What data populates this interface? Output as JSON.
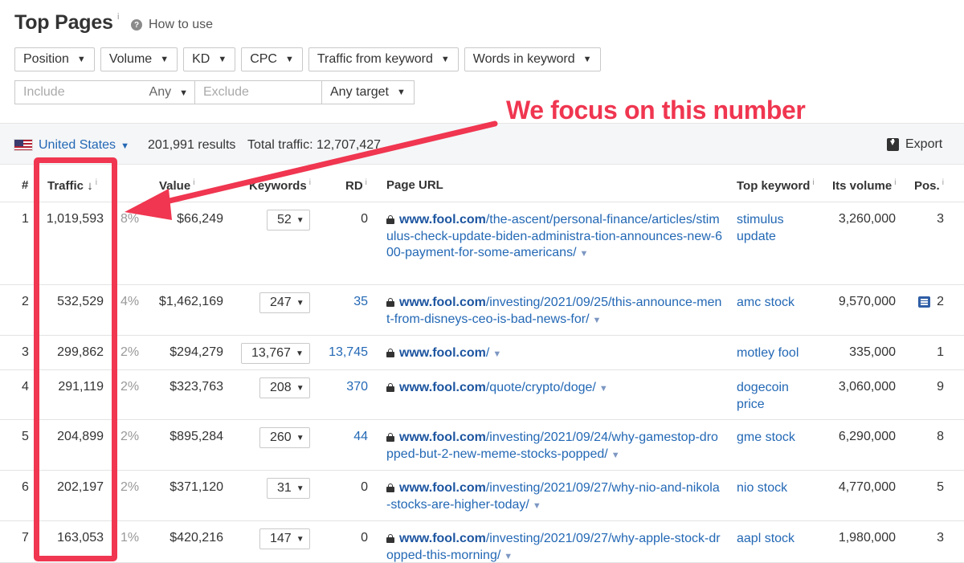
{
  "header": {
    "title": "Top Pages",
    "title_info": "i",
    "how_to_use": "How to use"
  },
  "filters": {
    "position": "Position",
    "volume": "Volume",
    "kd": "KD",
    "cpc": "CPC",
    "traffic_from_keyword": "Traffic from keyword",
    "words_in_keyword": "Words in keyword",
    "include_placeholder": "Include",
    "include_any": "Any",
    "exclude_placeholder": "Exclude",
    "target": "Any target"
  },
  "summary": {
    "country": "United States",
    "results": "201,991 results",
    "total_traffic": "Total traffic: 12,707,427",
    "export": "Export"
  },
  "table": {
    "headers": {
      "num": "#",
      "traffic": "Traffic",
      "value": "Value",
      "keywords": "Keywords",
      "rd": "RD",
      "page_url": "Page URL",
      "top_keyword": "Top keyword",
      "its_volume": "Its volume",
      "pos": "Pos."
    },
    "rows": [
      {
        "num": "1",
        "traffic": "1,019,593",
        "pct": "8%",
        "value": "$66,249",
        "keywords": "52",
        "rd": "0",
        "domain": "www.fool.com",
        "path": "/the-ascent/personal-finance/articles/stimulus-check-update-biden-administra-tion-announces-new-600-payment-for-some-americans/",
        "top_keyword": "stimulus update",
        "volume": "3,260,000",
        "pos": "3"
      },
      {
        "num": "2",
        "traffic": "532,529",
        "pct": "4%",
        "value": "$1,462,169",
        "keywords": "247",
        "rd": "35",
        "domain": "www.fool.com",
        "path": "/investing/2021/09/25/this-announce-ment-from-disneys-ceo-is-bad-news-for/",
        "top_keyword": "amc stock",
        "volume": "9,570,000",
        "pos": "2"
      },
      {
        "num": "3",
        "traffic": "299,862",
        "pct": "2%",
        "value": "$294,279",
        "keywords": "13,767",
        "rd": "13,745",
        "domain": "www.fool.com",
        "path": "/",
        "top_keyword": "motley fool",
        "volume": "335,000",
        "pos": "1"
      },
      {
        "num": "4",
        "traffic": "291,119",
        "pct": "2%",
        "value": "$323,763",
        "keywords": "208",
        "rd": "370",
        "domain": "www.fool.com",
        "path": "/quote/crypto/doge/",
        "top_keyword": "dogecoin price",
        "volume": "3,060,000",
        "pos": "9"
      },
      {
        "num": "5",
        "traffic": "204,899",
        "pct": "2%",
        "value": "$895,284",
        "keywords": "260",
        "rd": "44",
        "domain": "www.fool.com",
        "path": "/investing/2021/09/24/why-gamestop-dropped-but-2-new-meme-stocks-popped/",
        "top_keyword": "gme stock",
        "volume": "6,290,000",
        "pos": "8"
      },
      {
        "num": "6",
        "traffic": "202,197",
        "pct": "2%",
        "value": "$371,120",
        "keywords": "31",
        "rd": "0",
        "domain": "www.fool.com",
        "path": "/investing/2021/09/27/why-nio-and-nikola-stocks-are-higher-today/",
        "top_keyword": "nio stock",
        "volume": "4,770,000",
        "pos": "5"
      },
      {
        "num": "7",
        "traffic": "163,053",
        "pct": "1%",
        "value": "$420,216",
        "keywords": "147",
        "rd": "0",
        "domain": "www.fool.com",
        "path": "/investing/2021/09/27/why-apple-stock-dropped-this-morning/",
        "top_keyword": "aapl stock",
        "volume": "1,980,000",
        "pos": "3"
      }
    ]
  },
  "annotation": {
    "callout": "We focus on this number",
    "color": "#f03650"
  },
  "colors": {
    "link": "#2368b5",
    "accent": "#f03650"
  }
}
